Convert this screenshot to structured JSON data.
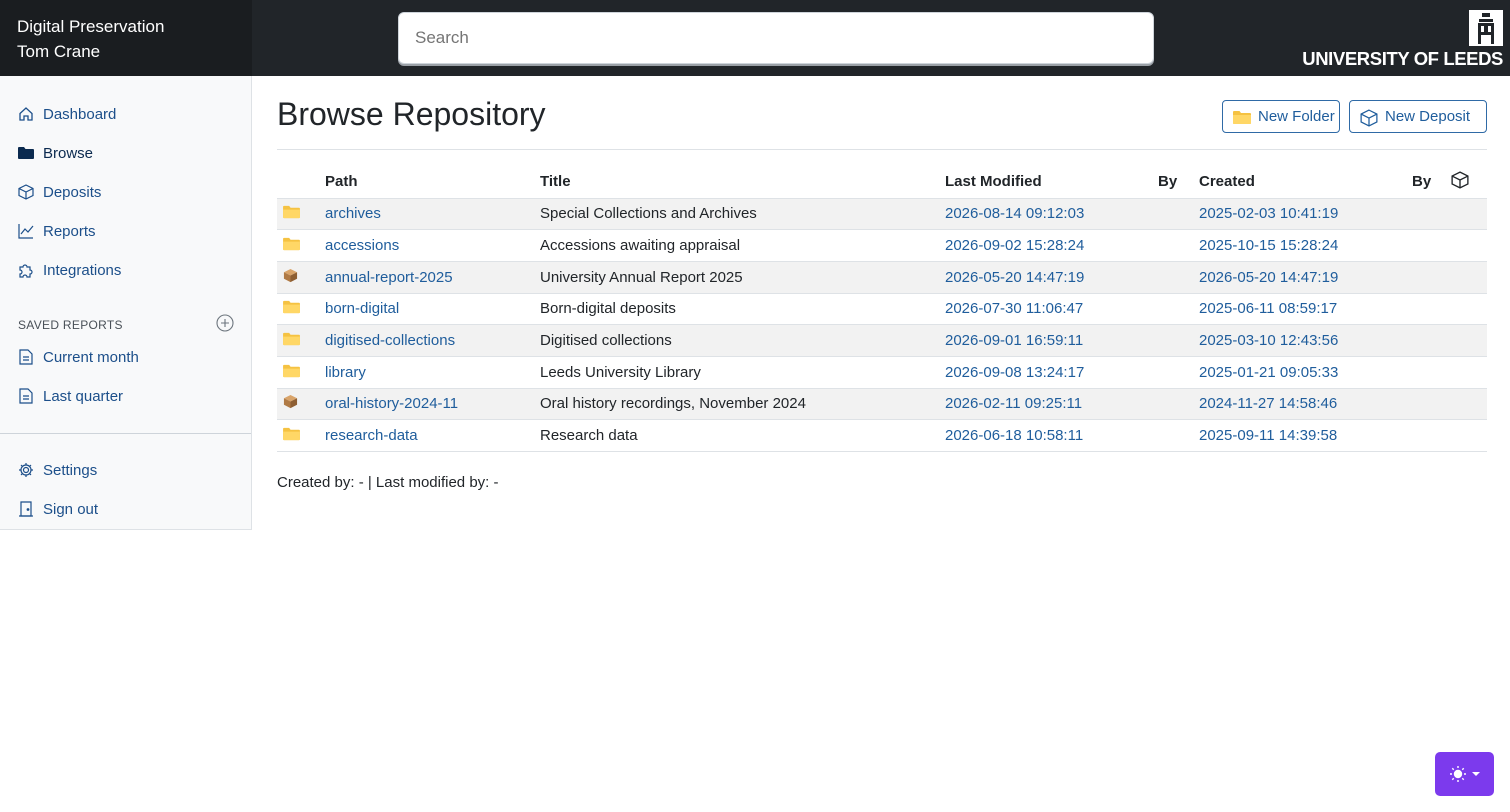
{
  "header": {
    "app_name": "Digital Preservation",
    "user_name": "Tom Crane",
    "search_placeholder": "Search",
    "logo_text": "UNIVERSITY OF LEEDS"
  },
  "sidebar": {
    "items": [
      {
        "label": "Dashboard",
        "icon": "home-icon"
      },
      {
        "label": "Browse",
        "icon": "folder-icon"
      },
      {
        "label": "Deposits",
        "icon": "box-icon"
      },
      {
        "label": "Reports",
        "icon": "chart-icon"
      },
      {
        "label": "Integrations",
        "icon": "puzzle-icon"
      }
    ],
    "saved_reports_label": "SAVED REPORTS",
    "saved_reports": [
      {
        "label": "Current month",
        "icon": "document-icon"
      },
      {
        "label": "Last quarter",
        "icon": "document-icon"
      }
    ],
    "bottom_items": [
      {
        "label": "Settings",
        "icon": "gear-icon"
      },
      {
        "label": "Sign out",
        "icon": "door-icon"
      }
    ]
  },
  "page": {
    "title": "Browse Repository",
    "new_folder_label": "New Folder",
    "new_deposit_label": "New Deposit"
  },
  "table": {
    "columns": [
      "Path",
      "Title",
      "Last Modified",
      "By",
      "Created",
      "By"
    ],
    "rows": [
      {
        "type": "folder",
        "path": "archives",
        "title": "Special Collections and Archives",
        "last_modified": "2026-08-14 09:12:03",
        "modified_by": "",
        "created": "2025-02-03 10:41:19",
        "created_by": ""
      },
      {
        "type": "folder",
        "path": "accessions",
        "title": "Accessions awaiting appraisal",
        "last_modified": "2026-09-02 15:28:24",
        "modified_by": "",
        "created": "2025-10-15 15:28:24",
        "created_by": ""
      },
      {
        "type": "archival-group",
        "path": "annual-report-2025",
        "title": "University Annual Report 2025",
        "last_modified": "2026-05-20 14:47:19",
        "modified_by": "",
        "created": "2026-05-20 14:47:19",
        "created_by": ""
      },
      {
        "type": "folder",
        "path": "born-digital",
        "title": "Born-digital deposits",
        "last_modified": "2026-07-30 11:06:47",
        "modified_by": "",
        "created": "2025-06-11 08:59:17",
        "created_by": ""
      },
      {
        "type": "folder",
        "path": "digitised-collections",
        "title": "Digitised collections",
        "last_modified": "2026-09-01 16:59:11",
        "modified_by": "",
        "created": "2025-03-10 12:43:56",
        "created_by": ""
      },
      {
        "type": "folder",
        "path": "library",
        "title": "Leeds University Library",
        "last_modified": "2026-09-08 13:24:17",
        "modified_by": "",
        "created": "2025-01-21 09:05:33",
        "created_by": ""
      },
      {
        "type": "archival-group",
        "path": "oral-history-2024-11",
        "title": "Oral history recordings, November 2024",
        "last_modified": "2026-02-11 09:25:11",
        "modified_by": "",
        "created": "2024-11-27 14:58:46",
        "created_by": ""
      },
      {
        "type": "folder",
        "path": "research-data",
        "title": "Research data",
        "last_modified": "2026-06-18 10:58:11",
        "modified_by": "",
        "created": "2025-09-11 14:39:58",
        "created_by": ""
      }
    ]
  },
  "footer_note": "Created by: - | Last modified by: -",
  "colors": {
    "topbar": "#212529",
    "link": "#1f5d9c",
    "folder": "#f5c242",
    "box": "#b07a45",
    "theme_button": "#7c3aed"
  },
  "theme_toggle_icon": "sun-icon"
}
